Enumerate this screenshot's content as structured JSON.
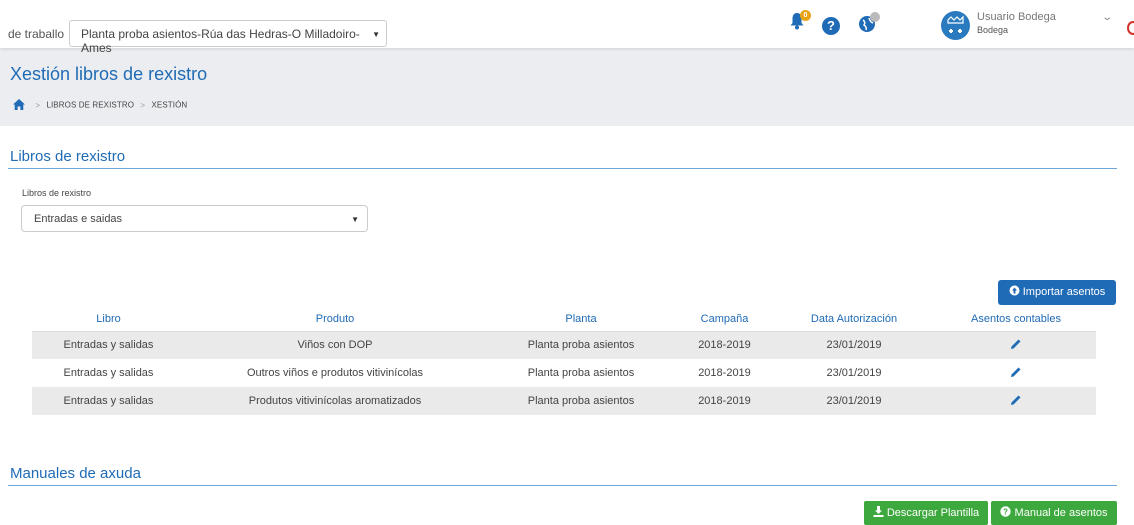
{
  "topbar": {
    "workplace_label": "de traballo",
    "workplace_value": "Planta proba asientos-Rúa das Hedras-O Milladoiro-Ames",
    "notifications_count": "0",
    "user_name": "Usuario Bodega",
    "user_role": "Bodega"
  },
  "header": {
    "title": "Xestión libros de rexistro",
    "breadcrumb": [
      "LIBROS DE REXISTRO",
      "XESTIÓN"
    ]
  },
  "books_section": {
    "title": "Libros de rexistro",
    "select_label": "Libros de rexistro",
    "select_value": "Entradas e saidas",
    "import_button": "Importar asentos"
  },
  "table": {
    "columns": [
      "Libro",
      "Produto",
      "Planta",
      "Campaña",
      "Data Autorización",
      "Asentos contables"
    ],
    "rows": [
      [
        "Entradas y salidas",
        "Viños con DOP",
        "Planta proba asientos",
        "2018-2019",
        "23/01/2019"
      ],
      [
        "Entradas y salidas",
        "Outros viños e produtos vitivinícolas",
        "Planta proba asientos",
        "2018-2019",
        "23/01/2019"
      ],
      [
        "Entradas y salidas",
        "Produtos vitivinícolas aromatizados",
        "Planta proba asientos",
        "2018-2019",
        "23/01/2019"
      ]
    ]
  },
  "manuals_section": {
    "title": "Manuales de axuda",
    "download_button": "Descargar Plantilla",
    "manual_button": "Manual de asentos"
  },
  "colors": {
    "brand_blue": "#1f6bb5",
    "success_green": "#3da83d",
    "badge_orange": "#e8a317",
    "power_red": "#d0332b"
  },
  "icons": [
    "bell-icon",
    "help-icon",
    "globe-icon",
    "avatar-icon",
    "chevron-down-icon",
    "power-icon",
    "home-icon",
    "pencil-icon",
    "upload-circle-icon",
    "download-icon",
    "question-circle-icon"
  ]
}
